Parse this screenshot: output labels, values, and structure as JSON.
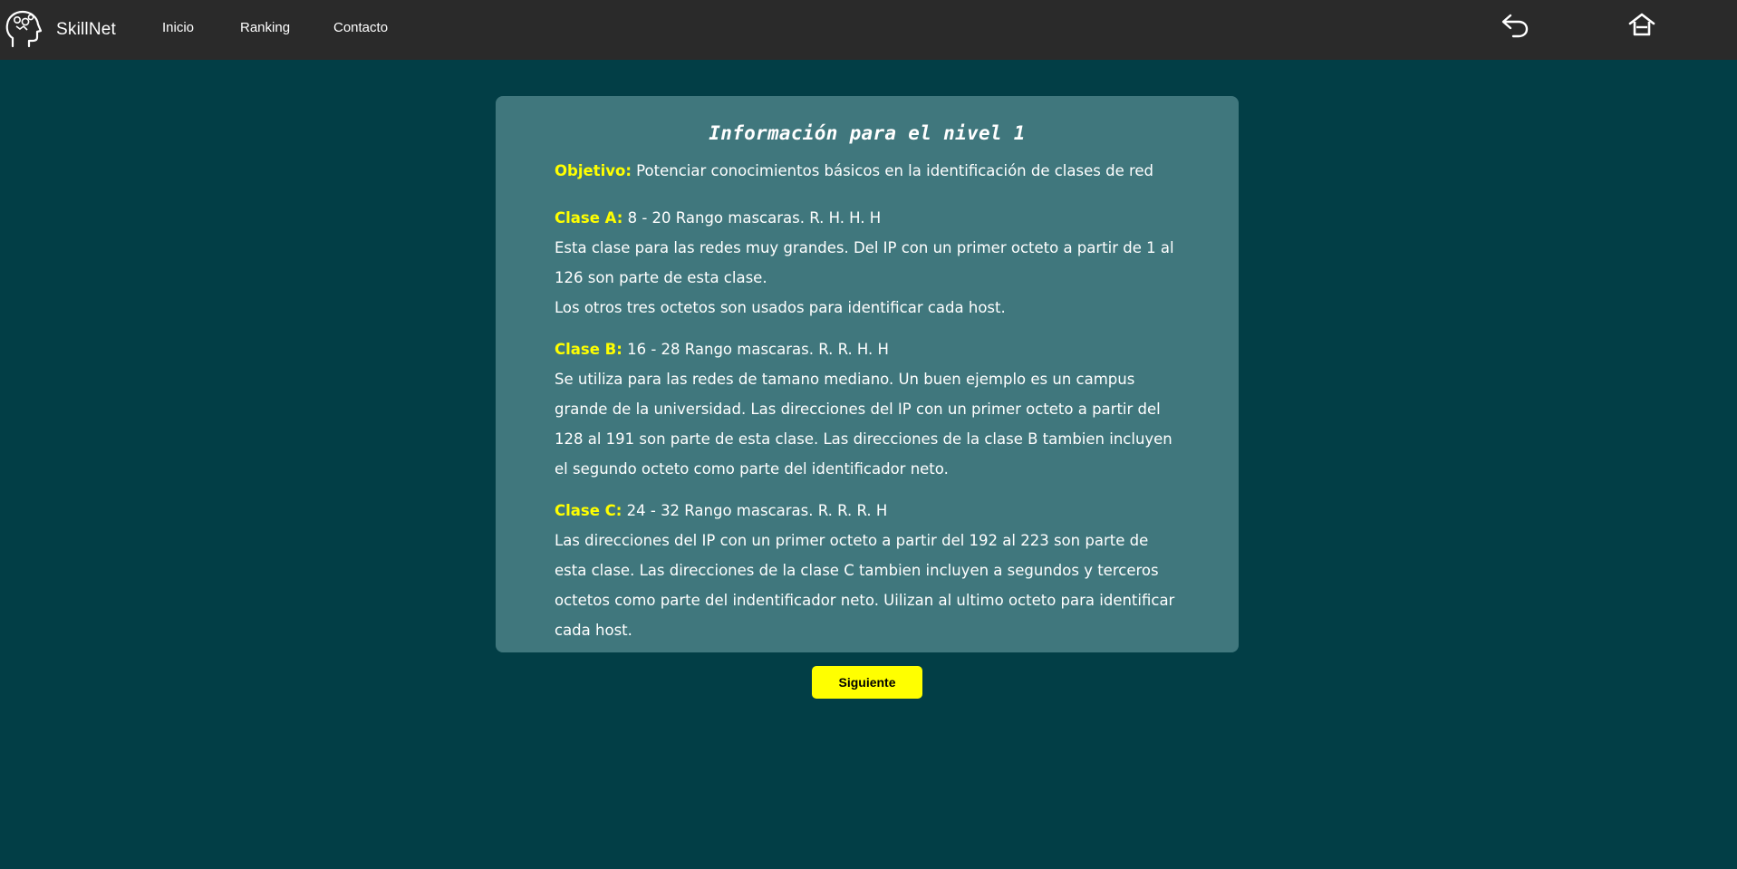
{
  "brand": {
    "name": "SkillNet",
    "logo_icon": "head-gears-icon"
  },
  "nav": {
    "links": [
      {
        "label": "Inicio"
      },
      {
        "label": "Ranking"
      },
      {
        "label": "Contacto"
      }
    ],
    "icons": [
      "back-arrow-icon",
      "home-icon"
    ]
  },
  "info": {
    "title": "Información para el nivel 1",
    "objective_label": "Objetivo:",
    "objective_text": "Potenciar conocimientos básicos en la identificación de clases de red",
    "classes": [
      {
        "label": "Clase A:",
        "range": "8 - 20 Rango mascaras. R. H. H. H",
        "lines": [
          "Esta clase para las redes muy grandes. Del IP con un primer octeto a partir de 1 al 126 son parte de esta clase.",
          "Los otros tres octetos son usados para identificar cada host."
        ]
      },
      {
        "label": "Clase B:",
        "range": "16 - 28 Rango mascaras. R. R. H. H",
        "lines": [
          "Se utiliza para las redes de tamano mediano. Un buen ejemplo es un campus grande de la universidad. Las direcciones del IP con un primer octeto a partir del 128 al 191 son parte de esta clase. Las direcciones de la clase B tambien incluyen el segundo octeto como parte del identificador neto."
        ]
      },
      {
        "label": "Clase C:",
        "range": "24 - 32 Rango mascaras. R. R. R. H",
        "lines": [
          "Las direcciones del IP con un primer octeto a partir del 192 al 223 son parte de esta clase. Las direcciones de la clase C tambien incluyen a segundos y terceros octetos como parte del indentificador neto. Uilizan al ultimo octeto para identificar cada host."
        ]
      }
    ]
  },
  "actions": {
    "next_label": "Siguiente"
  },
  "colors": {
    "background": "#023e46",
    "navbar": "#2a2a2a",
    "card": "#40777d",
    "accent": "#ffff00",
    "text": "#ffffff"
  }
}
